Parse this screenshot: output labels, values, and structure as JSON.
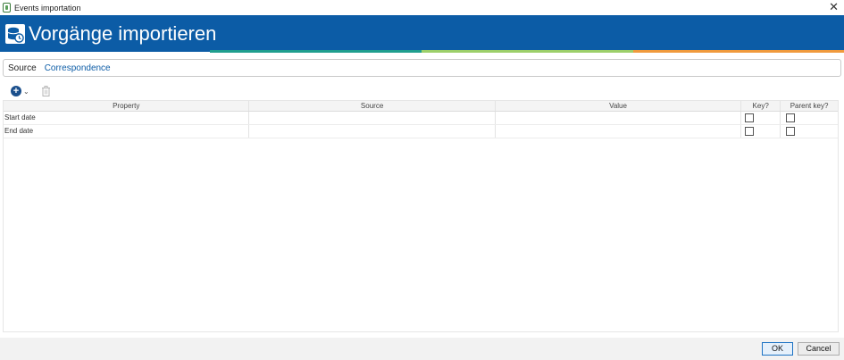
{
  "window": {
    "title": "Events importation"
  },
  "banner": {
    "title": "Vorgänge importieren"
  },
  "source": {
    "label": "Source",
    "value": "Correspondence"
  },
  "table": {
    "columns": [
      "Property",
      "Source",
      "Value",
      "Key?",
      "Parent key?"
    ],
    "rows": [
      {
        "property": "Start date",
        "source": "",
        "value": "",
        "key": false,
        "parent_key": false
      },
      {
        "property": "End date",
        "source": "",
        "value": "",
        "key": false,
        "parent_key": false
      }
    ]
  },
  "buttons": {
    "ok": "OK",
    "cancel": "Cancel"
  },
  "colors": {
    "banner": "#0c5ca6",
    "stripe_teal": "#1f9e8e",
    "stripe_green": "#9ccf6a",
    "stripe_orange": "#f09a3d"
  }
}
